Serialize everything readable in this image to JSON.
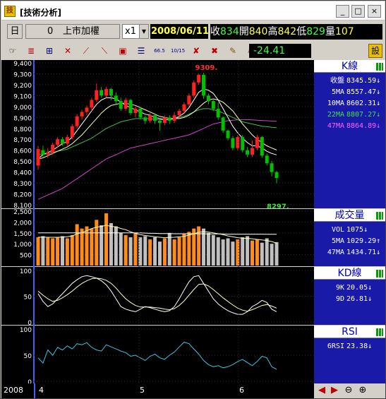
{
  "window": {
    "title": "[技術分析]",
    "app_icon": "chart-app-icon",
    "buttons": [
      "_",
      "□",
      "×"
    ]
  },
  "toolbar": {
    "period_label": "日",
    "symbol_code": "0",
    "symbol_name": "上市加權",
    "zoom_value": "x1",
    "date": "2008/06/11",
    "quote": {
      "close_label": "收",
      "close": "834",
      "open_label": "開",
      "open": "840",
      "high_label": "高",
      "high": "842",
      "low_label": "低",
      "low": "829",
      "vol_label": "量",
      "vol": "107"
    },
    "right_icon": "設",
    "change_value": "-24.41",
    "tools": [
      "hand-icon",
      "fib-retracement-icon",
      "channel-icon",
      "trendline-icon",
      "fan-icon",
      "fan-down-icon",
      "box-icon",
      "gann-grid-icon",
      "period-66-icon",
      "period-1015-icon",
      "delete-icon",
      "delete-all-icon",
      "magic-pen-icon",
      "text-pen-icon"
    ],
    "tool_labels": {
      "period_66": "66.5",
      "period_1015": "10/15"
    }
  },
  "colors": {
    "background": "#000000",
    "up": "#ff2020",
    "down": "#00c000",
    "ma5": "#ffffff",
    "ma10": "#ffffc0",
    "ma22": "#40c040",
    "ma47": "#d040d0",
    "vol_up": "#ff8c1a",
    "vol_down": "#c0c0c0",
    "rsi": "#40c0e0",
    "kline": "#ffffff",
    "dline": "#ffffc0",
    "panel_bg": "#1a1aa8"
  },
  "panels": {
    "kline": {
      "title": "K線",
      "rows": [
        {
          "label": "收盤",
          "value": "8345.59",
          "arrow": "↓",
          "color": "#ffffff"
        },
        {
          "label": "5MA",
          "value": "8557.47",
          "arrow": "↓",
          "color": "#ffffff"
        },
        {
          "label": "10MA",
          "value": "8602.31",
          "arrow": "↓",
          "color": "#ffffff"
        },
        {
          "label": "22MA",
          "value": "8807.27",
          "arrow": "↓",
          "color": "#40e040"
        },
        {
          "label": "47MA",
          "value": "8864.89",
          "arrow": "↓",
          "color": "#ff60ff"
        }
      ]
    },
    "volume": {
      "title": "成交量",
      "rows": [
        {
          "label": "VOL",
          "value": "1075",
          "arrow": "↓",
          "color": "#ffffff"
        },
        {
          "label": "5MA",
          "value": "1029.29",
          "arrow": "↑",
          "color": "#ffffff"
        },
        {
          "label": "47MA",
          "value": "1434.71",
          "arrow": "↓",
          "color": "#ffffff"
        }
      ]
    },
    "kd": {
      "title": "KD線",
      "rows": [
        {
          "label": "9K",
          "value": "20.05",
          "arrow": "↓",
          "color": "#ffffff"
        },
        {
          "label": "9D",
          "value": "26.81",
          "arrow": "↓",
          "color": "#ffffff"
        }
      ]
    },
    "rsi": {
      "title": "RSI",
      "rows": [
        {
          "label": "6RSI",
          "value": "23.38",
          "arrow": "↓",
          "color": "#ffffff"
        }
      ]
    }
  },
  "bottom": {
    "year": "2008",
    "months": [
      "4",
      "5",
      "6"
    ],
    "nav_icons": [
      "scroll-left-icon",
      "scroll-right-icon",
      "zoom-out-icon",
      "zoom-in-icon"
    ]
  },
  "chart_data": [
    {
      "type": "candlestick",
      "ylim": [
        8100,
        9400
      ],
      "yticks": [
        "9,400",
        "9,300",
        "9,200",
        "9,100",
        "9,000",
        "8,900",
        "8,800",
        "8,700",
        "8,600",
        "8,500",
        "8,400",
        "8,300",
        "8,200",
        "8,100"
      ],
      "high_label": "9309.",
      "low_label": "8297.",
      "candles": [
        [
          8460,
          8610,
          8420,
          8640
        ],
        [
          8600,
          8560,
          8540,
          8640
        ],
        [
          8560,
          8580,
          8530,
          8620
        ],
        [
          8580,
          8650,
          8560,
          8670
        ],
        [
          8650,
          8700,
          8620,
          8720
        ],
        [
          8700,
          8660,
          8640,
          8720
        ],
        [
          8660,
          8720,
          8640,
          8740
        ],
        [
          8720,
          8820,
          8700,
          8840
        ],
        [
          8820,
          8910,
          8800,
          8930
        ],
        [
          8910,
          8950,
          8880,
          8970
        ],
        [
          8950,
          8990,
          8920,
          9010
        ],
        [
          8990,
          9060,
          8960,
          9080
        ],
        [
          9060,
          9150,
          9040,
          9210
        ],
        [
          9150,
          9100,
          9080,
          9180
        ],
        [
          9100,
          9160,
          9080,
          9180
        ],
        [
          9160,
          9100,
          9060,
          9170
        ],
        [
          9100,
          9050,
          9020,
          9130
        ],
        [
          9050,
          8980,
          8960,
          9080
        ],
        [
          8980,
          9060,
          8960,
          9080
        ],
        [
          9060,
          8940,
          8920,
          9070
        ],
        [
          8940,
          8980,
          8900,
          9000
        ],
        [
          8980,
          8900,
          8880,
          9000
        ],
        [
          8900,
          8870,
          8840,
          8920
        ],
        [
          8870,
          8920,
          8850,
          8940
        ],
        [
          8920,
          8870,
          8840,
          8940
        ],
        [
          8870,
          8850,
          8780,
          8880
        ],
        [
          8850,
          8900,
          8830,
          8920
        ],
        [
          8900,
          8870,
          8840,
          8920
        ],
        [
          8870,
          8920,
          8850,
          8950
        ],
        [
          8920,
          8960,
          8900,
          8980
        ],
        [
          8960,
          9020,
          8940,
          9040
        ],
        [
          9020,
          9100,
          9000,
          9120
        ],
        [
          9100,
          9220,
          9080,
          9240
        ],
        [
          9220,
          9290,
          9200,
          9300
        ],
        [
          9290,
          9100,
          9070,
          9309
        ],
        [
          9100,
          9050,
          9020,
          9120
        ],
        [
          9050,
          8980,
          8960,
          9060
        ],
        [
          8980,
          8900,
          8880,
          9040
        ],
        [
          8900,
          8780,
          8760,
          8910
        ],
        [
          8780,
          8710,
          8690,
          8790
        ],
        [
          8710,
          8620,
          8600,
          8730
        ],
        [
          8620,
          8720,
          8600,
          8740
        ],
        [
          8720,
          8600,
          8580,
          8740
        ],
        [
          8600,
          8560,
          8540,
          8630
        ],
        [
          8560,
          8620,
          8540,
          8690
        ],
        [
          8620,
          8720,
          8600,
          8740
        ],
        [
          8720,
          8550,
          8530,
          8730
        ],
        [
          8550,
          8480,
          8460,
          8570
        ],
        [
          8480,
          8400,
          8360,
          8500
        ],
        [
          8400,
          8345,
          8297,
          8410
        ]
      ],
      "ma5": [
        8520,
        8560,
        8580,
        8600,
        8630,
        8660,
        8680,
        8720,
        8780,
        8840,
        8900,
        8960,
        9020,
        9060,
        9080,
        9080,
        9070,
        9040,
        9010,
        8990,
        8970,
        8950,
        8930,
        8920,
        8900,
        8890,
        8880,
        8880,
        8890,
        8910,
        8940,
        8990,
        9060,
        9130,
        9160,
        9150,
        9120,
        9060,
        8980,
        8900,
        8820,
        8760,
        8710,
        8670,
        8640,
        8640,
        8620,
        8590,
        8570,
        8557
      ],
      "ma10": [
        8520,
        8530,
        8550,
        8570,
        8590,
        8610,
        8630,
        8660,
        8700,
        8740,
        8790,
        8840,
        8890,
        8940,
        8980,
        9010,
        9020,
        9030,
        9030,
        9020,
        9010,
        8990,
        8970,
        8950,
        8930,
        8910,
        8900,
        8890,
        8890,
        8890,
        8900,
        8920,
        8950,
        8990,
        9030,
        9060,
        9070,
        9060,
        9040,
        9000,
        8960,
        8900,
        8840,
        8790,
        8740,
        8700,
        8670,
        8640,
        8620,
        8602
      ],
      "ma22": [
        8560,
        8560,
        8570,
        8580,
        8590,
        8600,
        8610,
        8630,
        8650,
        8670,
        8690,
        8710,
        8740,
        8770,
        8800,
        8820,
        8840,
        8860,
        8870,
        8880,
        8890,
        8890,
        8890,
        8890,
        8880,
        8880,
        8880,
        8880,
        8890,
        8900,
        8910,
        8930,
        8950,
        8970,
        8980,
        8980,
        8970,
        8960,
        8940,
        8920,
        8900,
        8880,
        8860,
        8850,
        8840,
        8830,
        8820,
        8815,
        8810,
        8807
      ],
      "ma47": [
        8150,
        8170,
        8190,
        8210,
        8230,
        8250,
        8280,
        8310,
        8340,
        8370,
        8400,
        8430,
        8460,
        8490,
        8520,
        8540,
        8560,
        8580,
        8600,
        8620,
        8630,
        8640,
        8650,
        8660,
        8670,
        8680,
        8690,
        8700,
        8710,
        8720,
        8730,
        8740,
        8760,
        8780,
        8800,
        8820,
        8840,
        8850,
        8860,
        8870,
        8875,
        8878,
        8880,
        8880,
        8878,
        8875,
        8872,
        8870,
        8867,
        8865
      ]
    },
    {
      "type": "bar",
      "ylim": [
        0,
        2500
      ],
      "yticks": [
        "2,500",
        "2,000",
        "1,500",
        "1,000",
        "500"
      ],
      "values": [
        1300,
        1350,
        1280,
        1250,
        1300,
        1350,
        1250,
        1400,
        1900,
        1700,
        1800,
        1700,
        2100,
        1850,
        2400,
        1950,
        1800,
        1500,
        1400,
        1300,
        1500,
        1300,
        1350,
        1200,
        1300,
        1100,
        1250,
        1500,
        1200,
        1300,
        1450,
        1550,
        1700,
        1800,
        1700,
        1500,
        1400,
        1300,
        1200,
        1250,
        1100,
        1200,
        1300,
        1350,
        1150,
        1200,
        1050,
        1250,
        1000,
        1075
      ],
      "up": [
        true,
        false,
        true,
        true,
        true,
        false,
        true,
        true,
        true,
        true,
        true,
        true,
        true,
        false,
        true,
        false,
        false,
        false,
        true,
        false,
        true,
        false,
        false,
        true,
        false,
        false,
        true,
        false,
        true,
        true,
        true,
        true,
        true,
        true,
        false,
        false,
        false,
        false,
        false,
        false,
        false,
        true,
        false,
        false,
        true,
        true,
        false,
        false,
        false,
        false
      ],
      "ma5": [
        1300,
        1310,
        1300,
        1300,
        1300,
        1310,
        1320,
        1360,
        1450,
        1520,
        1600,
        1700,
        1760,
        1800,
        1850,
        1800,
        1780,
        1700,
        1650,
        1550,
        1480,
        1420,
        1380,
        1350,
        1320,
        1300,
        1280,
        1290,
        1300,
        1320,
        1340,
        1400,
        1460,
        1530,
        1560,
        1540,
        1500,
        1460,
        1420,
        1360,
        1320,
        1280,
        1260,
        1250,
        1230,
        1200,
        1180,
        1150,
        1100,
        1029
      ],
      "ma47": [
        1500,
        1500,
        1500,
        1500,
        1500,
        1500,
        1500,
        1500,
        1500,
        1500,
        1500,
        1500,
        1500,
        1500,
        1500,
        1500,
        1500,
        1500,
        1500,
        1500,
        1500,
        1500,
        1490,
        1480,
        1480,
        1470,
        1470,
        1470,
        1460,
        1460,
        1460,
        1460,
        1460,
        1460,
        1460,
        1450,
        1450,
        1450,
        1450,
        1440,
        1440,
        1440,
        1440,
        1440,
        1440,
        1440,
        1440,
        1435,
        1435,
        1435
      ]
    },
    {
      "type": "line",
      "ylim": [
        0,
        100
      ],
      "yticks": [
        "100",
        "50",
        "0"
      ],
      "series": [
        {
          "values": [
            55,
            40,
            30,
            35,
            45,
            55,
            65,
            75,
            82,
            88,
            90,
            88,
            85,
            80,
            72,
            60,
            45,
            30,
            25,
            22,
            20,
            25,
            30,
            28,
            25,
            22,
            20,
            22,
            30,
            45,
            62,
            78,
            88,
            90,
            75,
            60,
            45,
            35,
            28,
            22,
            18,
            15,
            15,
            20,
            30,
            35,
            42,
            38,
            25,
            20
          ]
        },
        {
          "values": [
            60,
            52,
            45,
            40,
            42,
            47,
            53,
            60,
            68,
            75,
            80,
            84,
            85,
            84,
            81,
            75,
            66,
            55,
            45,
            38,
            32,
            29,
            29,
            29,
            28,
            27,
            25,
            24,
            26,
            32,
            41,
            52,
            63,
            73,
            74,
            70,
            63,
            55,
            47,
            40,
            33,
            27,
            23,
            21,
            24,
            28,
            32,
            34,
            31,
            27
          ]
        }
      ]
    },
    {
      "type": "line",
      "ylim": [
        0,
        100
      ],
      "yticks": [
        "100",
        "50",
        "0"
      ],
      "series": [
        {
          "values": [
            45,
            35,
            60,
            50,
            65,
            60,
            68,
            62,
            72,
            70,
            74,
            65,
            60,
            58,
            70,
            66,
            62,
            58,
            55,
            48,
            50,
            45,
            40,
            48,
            52,
            45,
            42,
            50,
            56,
            66,
            75,
            72,
            62,
            52,
            40,
            32,
            28,
            30,
            26,
            28,
            32,
            38,
            42,
            36,
            30,
            38,
            48,
            45,
            28,
            23
          ]
        }
      ]
    }
  ]
}
